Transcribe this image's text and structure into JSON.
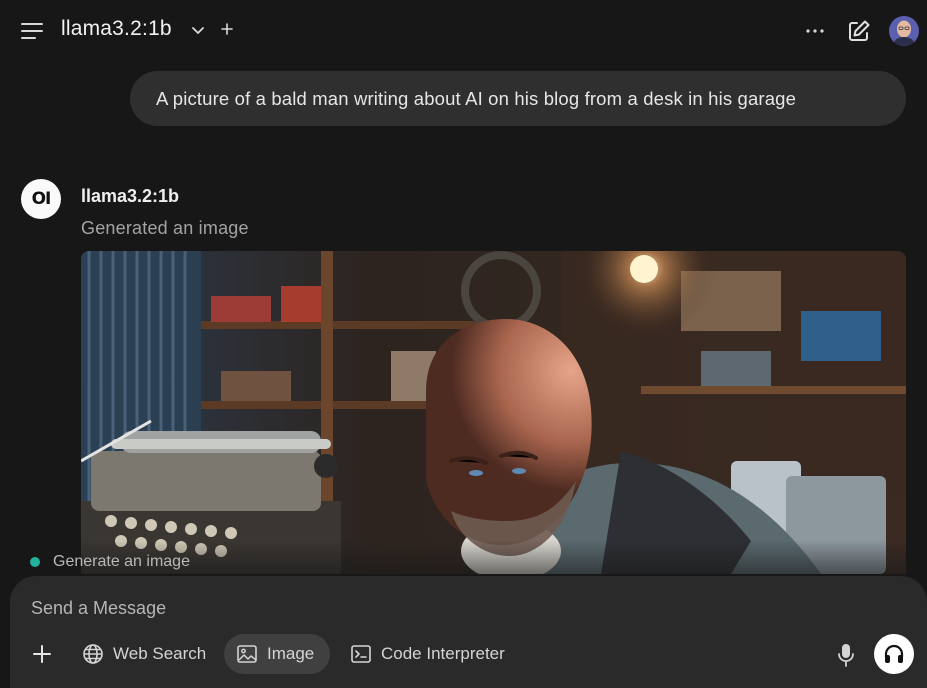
{
  "header": {
    "model_name": "llama3.2:1b",
    "icons": {
      "menu": "hamburger-icon",
      "chevron": "chevron-down-icon",
      "add": "plus-icon",
      "more": "ellipsis-icon",
      "new_chat": "pencil-square-icon"
    }
  },
  "user_message": {
    "text": "A picture of a bald man writing about AI on his blog from a desk in his garage"
  },
  "assistant_message": {
    "avatar_text": "OI",
    "name": "llama3.2:1b",
    "status": "Generated an image"
  },
  "status_indicator": {
    "label": "Generate an image",
    "color": "#22b39b"
  },
  "composer": {
    "placeholder": "Send a Message",
    "tools": [
      {
        "label": "Web Search",
        "icon": "globe-icon",
        "active": false
      },
      {
        "label": "Image",
        "icon": "image-icon",
        "active": true
      },
      {
        "label": "Code Interpreter",
        "icon": "terminal-icon",
        "active": false
      }
    ],
    "icons": {
      "add": "plus-icon",
      "mic": "microphone-icon",
      "call": "headphones-icon"
    }
  }
}
